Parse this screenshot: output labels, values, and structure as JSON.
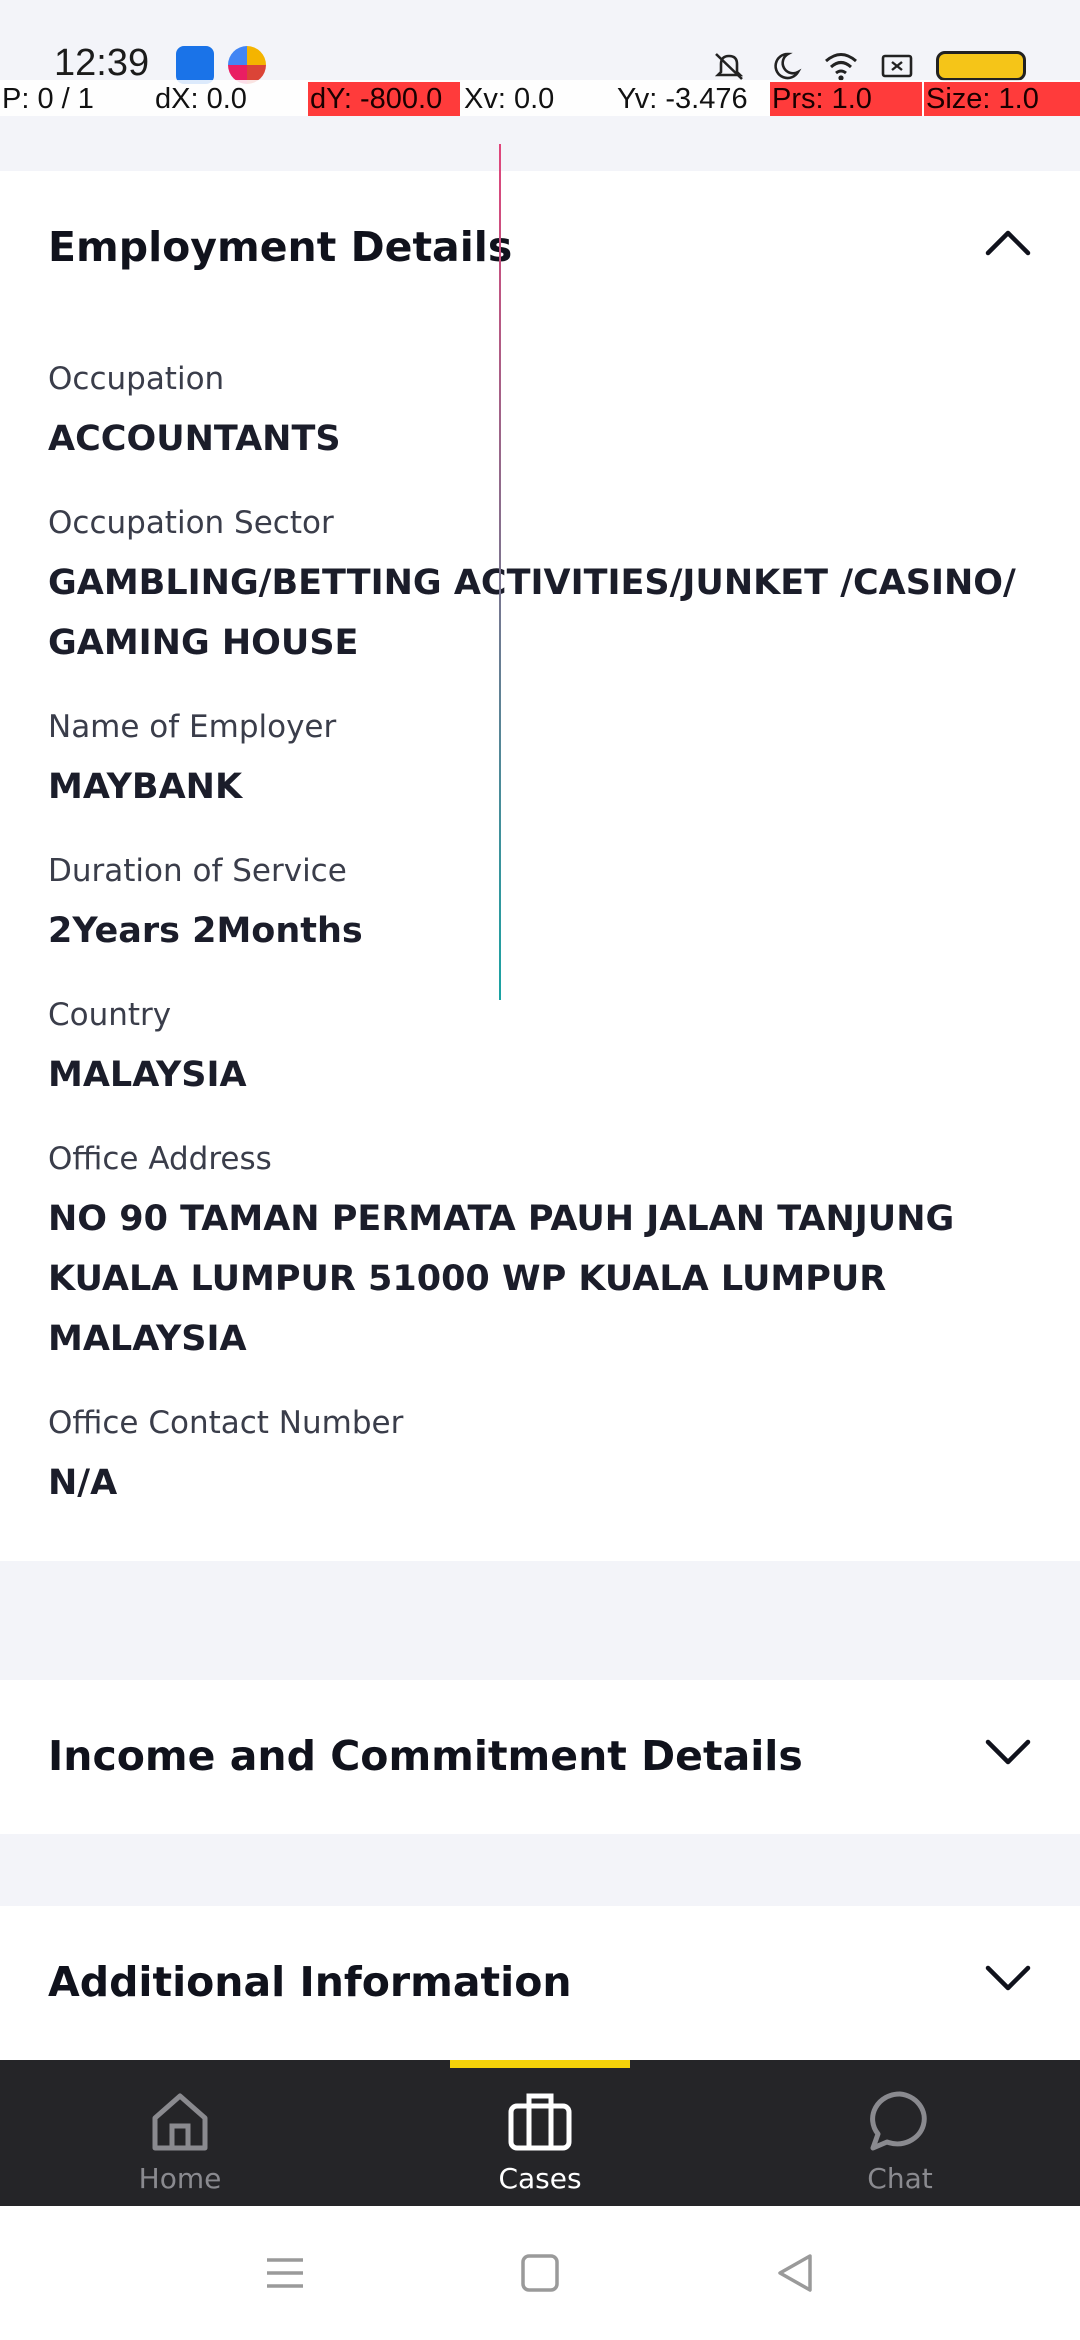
{
  "status_bar": {
    "time": "12:39"
  },
  "debug_overlay": {
    "pointer": "P: 0 / 1",
    "dx": "dX: 0.0",
    "dy": "dY: -800.0",
    "xv": "Xv: 0.0",
    "yv": "Yv: -3.476",
    "prs": "Prs: 1.0",
    "size": "Size: 1.0",
    "highlight_color": "#ff3b3b"
  },
  "employment": {
    "title": "Employment Details",
    "expanded": true,
    "icon": "chevron-up-icon",
    "fields": {
      "occupation": {
        "label": "Occupation",
        "value": "ACCOUNTANTS"
      },
      "sector": {
        "label": "Occupation Sector",
        "value": "GAMBLING/BETTING ACTIVITIES/JUNKET /CASINO/ GAMING HOUSE"
      },
      "employer": {
        "label": "Name of Employer",
        "value": "MAYBANK"
      },
      "duration": {
        "label": "Duration of Service",
        "value": "2Years 2Months"
      },
      "country": {
        "label": "Country",
        "value": "MALAYSIA"
      },
      "address": {
        "label": "Office Address",
        "value": "NO 90 TAMAN PERMATA PAUH JALAN TANJUNG KUALA LUMPUR 51000 WP KUALA LUMPUR MALAYSIA"
      },
      "contact": {
        "label": "Office Contact Number",
        "value": "N/A"
      }
    }
  },
  "income": {
    "title": "Income and Commitment Details",
    "expanded": false,
    "icon": "chevron-down-icon"
  },
  "additional": {
    "title": "Additional Information",
    "expanded": false,
    "icon": "chevron-down-icon"
  },
  "bottom_nav": {
    "accent_color": "#f5d20a",
    "items": [
      {
        "label": "Home",
        "icon": "home-icon",
        "active": false
      },
      {
        "label": "Cases",
        "icon": "briefcase-icon",
        "active": true
      },
      {
        "label": "Chat",
        "icon": "chat-icon",
        "active": false
      }
    ]
  },
  "system_nav": {
    "buttons": [
      "menu-icon",
      "home-square-icon",
      "back-icon"
    ]
  }
}
